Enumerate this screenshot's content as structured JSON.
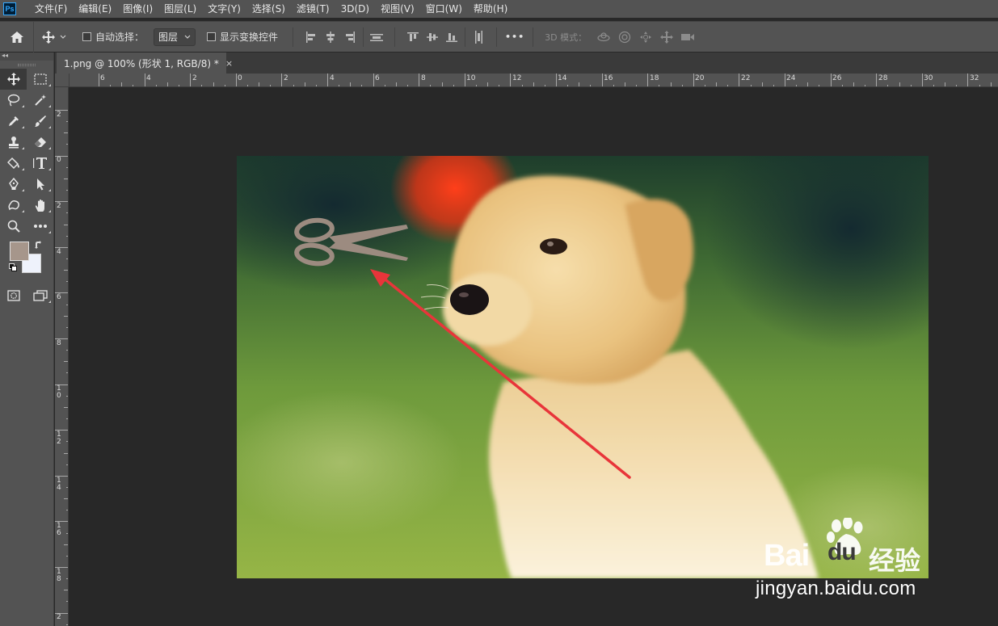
{
  "app": {
    "logo_text": "Ps"
  },
  "menu": [
    {
      "label": "文件(F)"
    },
    {
      "label": "编辑(E)"
    },
    {
      "label": "图像(I)"
    },
    {
      "label": "图层(L)"
    },
    {
      "label": "文字(Y)"
    },
    {
      "label": "选择(S)"
    },
    {
      "label": "滤镜(T)"
    },
    {
      "label": "3D(D)"
    },
    {
      "label": "视图(V)"
    },
    {
      "label": "窗口(W)"
    },
    {
      "label": "帮助(H)"
    }
  ],
  "options": {
    "auto_select_label": "自动选择：",
    "layer_select_value": "图层",
    "show_transform_label": "显示变换控件",
    "more_label": "•••",
    "mode_3d_label": "3D 模式："
  },
  "document": {
    "tab_label": "1.png @ 100% (形状 1, RGB/8) *",
    "close_glyph": "×"
  },
  "toolbar": {
    "collapse_glyph": "◂◂"
  },
  "colors": {
    "foreground": "#a6968b",
    "background": "#eef2fb",
    "arrow": "#e8353a",
    "scissors": "#9c8b80"
  },
  "rulers": {
    "horizontal": [
      "6",
      "4",
      "2",
      "0",
      "2",
      "4",
      "6",
      "8",
      "10",
      "12",
      "14",
      "16",
      "18",
      "20",
      "22",
      "24",
      "26",
      "28",
      "30",
      "32"
    ],
    "vertical": [
      "2",
      "0",
      "2",
      "4",
      "6",
      "8",
      "1 0",
      "1 2",
      "1 4",
      "1 6",
      "1 8",
      "2"
    ]
  },
  "watermark": {
    "brand_left": "Bai",
    "brand_mid": "du",
    "brand_right": "经验",
    "url": "jingyan.baidu.com"
  }
}
